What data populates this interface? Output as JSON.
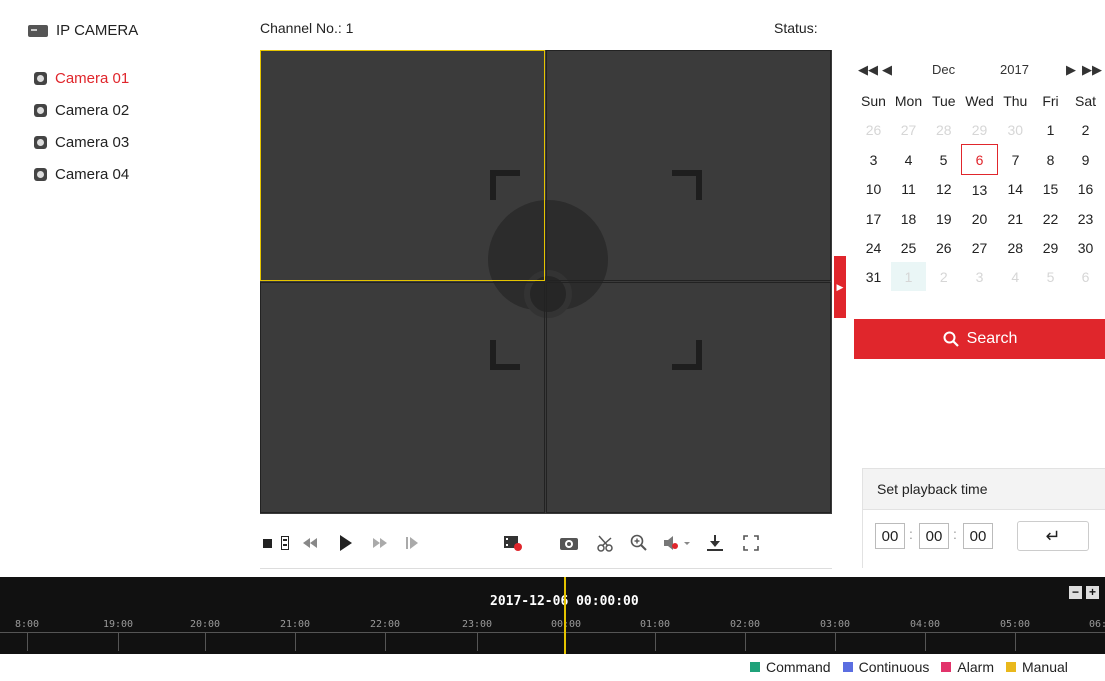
{
  "tree": {
    "root_label": "IP CAMERA",
    "cameras": [
      {
        "label": "Camera 01",
        "selected": true
      },
      {
        "label": "Camera 02",
        "selected": false
      },
      {
        "label": "Camera 03",
        "selected": false
      },
      {
        "label": "Camera 04",
        "selected": false
      }
    ]
  },
  "header": {
    "channel_label": "Channel No.: 1",
    "status_label": "Status:"
  },
  "calendar": {
    "month": "Dec",
    "year": "2017",
    "nav": {
      "prev_year": "◀◀",
      "prev_month": "◀",
      "next_month": "▶",
      "next_year": "▶▶"
    },
    "weekdays": [
      "Sun",
      "Mon",
      "Tue",
      "Wed",
      "Thu",
      "Fri",
      "Sat"
    ],
    "weeks": [
      [
        "26",
        "27",
        "28",
        "29",
        "30",
        "1",
        "2"
      ],
      [
        "3",
        "4",
        "5",
        "6",
        "7",
        "8",
        "9"
      ],
      [
        "10",
        "11",
        "12",
        "13",
        "14",
        "15",
        "16"
      ],
      [
        "17",
        "18",
        "19",
        "20",
        "21",
        "22",
        "23"
      ],
      [
        "24",
        "25",
        "26",
        "27",
        "28",
        "29",
        "30"
      ],
      [
        "31",
        "1",
        "2",
        "3",
        "4",
        "5",
        "6"
      ]
    ],
    "today": "6"
  },
  "search": {
    "label": "Search"
  },
  "playback_time": {
    "title": "Set playback time",
    "hh": "00",
    "mm": "00",
    "ss": "00"
  },
  "timeline": {
    "current": "2017-12-06 00:00:00",
    "hours": [
      "8:00",
      "19:00",
      "20:00",
      "21:00",
      "22:00",
      "23:00",
      "00:00",
      "01:00",
      "02:00",
      "03:00",
      "04:00",
      "05:00",
      "06:"
    ],
    "zoom_out": "−",
    "zoom_in": "+"
  },
  "legend": [
    {
      "label": "Command",
      "color": "#1fa27a"
    },
    {
      "label": "Continuous",
      "color": "#5b6ee1"
    },
    {
      "label": "Alarm",
      "color": "#e2336b"
    },
    {
      "label": "Manual",
      "color": "#e9b81c"
    }
  ],
  "colors": {
    "accent": "#e0262c",
    "active_pane": "#e5c400"
  }
}
